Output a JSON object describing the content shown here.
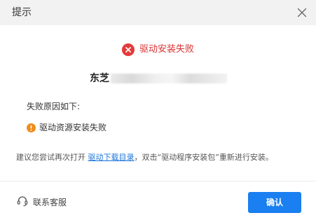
{
  "dialog": {
    "title": "提示",
    "status_message": "驱动安装失败",
    "device_name": "东芝",
    "reason_label": "失败原因如下:",
    "reason_item": "驱动资源安装失败",
    "suggestion": {
      "prefix": "建议您尝试再次打开 ",
      "link_text": "驱动下载目录",
      "suffix": "，双击“驱动程序安装包”重新进行安装。"
    },
    "support_label": "联系客服",
    "confirm_label": "确认"
  },
  "icons": {
    "close": "close-icon",
    "error": "error-circle-icon",
    "warning": "warning-circle-icon",
    "support": "headset-icon"
  },
  "colors": {
    "titlebar_bg": "#f2f2f2",
    "error": "#e63a3a",
    "warning": "#f08c1a",
    "link": "#1a73d9",
    "primary_button": "#1a7ff0"
  }
}
